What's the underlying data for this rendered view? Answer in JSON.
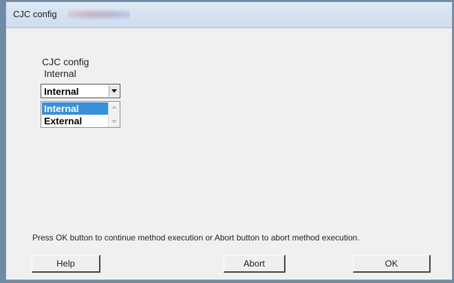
{
  "window": {
    "title": "CJC config"
  },
  "group": {
    "heading": "CJC config",
    "current_label": "Internal"
  },
  "combo": {
    "value": "Internal"
  },
  "dropdown": {
    "options": [
      "Internal",
      "External"
    ],
    "selected": "Internal"
  },
  "message": "Press OK button to continue method execution or Abort button to abort method execution.",
  "buttons": {
    "help": "Help",
    "abort": "Abort",
    "ok": "OK"
  }
}
